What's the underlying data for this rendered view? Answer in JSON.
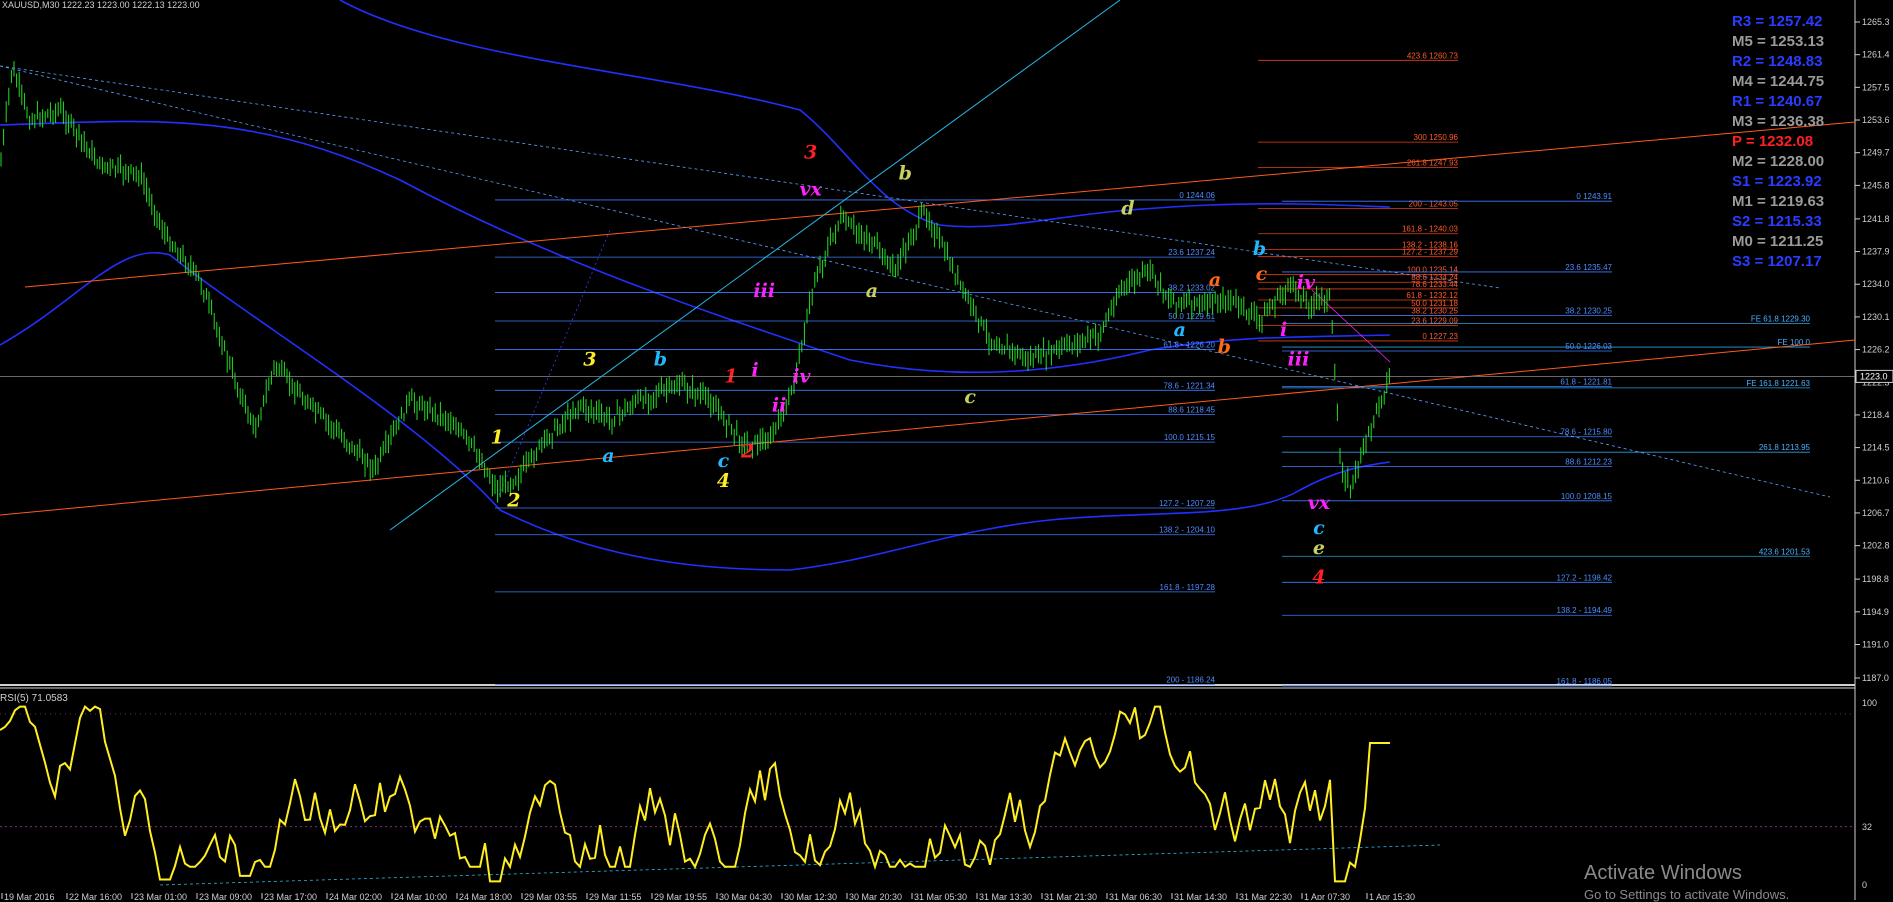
{
  "window_title": "XAUUSD,M30  1222.23 1223.00 1222.13 1223.00",
  "rsi_title": "RSI(5) 71.0583",
  "price_axis_labels": [
    "1265.3",
    "1261.4",
    "1257.5",
    "1253.6",
    "1249.7",
    "1245.8",
    "1241.8",
    "1237.9",
    "1234.0",
    "1230.1",
    "1226.2",
    "1222.3",
    "1218.4",
    "1214.5",
    "1210.6",
    "1206.7",
    "1202.8",
    "1198.8",
    "1194.9",
    "1191.0",
    "1187.0"
  ],
  "current_price": "1223.0",
  "rsi_axis_labels": [
    "100",
    "32",
    "0"
  ],
  "time_axis_labels": [
    "19 Mar 2016",
    "22 Mar 16:00",
    "23 Mar 01:00",
    "23 Mar 09:00",
    "23 Mar 17:00",
    "24 Mar 02:00",
    "24 Mar 10:00",
    "24 Mar 18:00",
    "29 Mar 03:55",
    "29 Mar 11:55",
    "29 Mar 19:55",
    "30 Mar 04:30",
    "30 Mar 12:30",
    "30 Mar 20:30",
    "31 Mar 05:30",
    "31 Mar 13:30",
    "31 Mar 21:30",
    "31 Mar 06:30",
    "31 Mar 14:30",
    "31 Mar 22:30",
    "1 Apr 07:30",
    "1 Apr 15:30"
  ],
  "pivots": [
    {
      "label": "R3 = 1257.42",
      "color": "#2a3cff"
    },
    {
      "label": "M5 = 1253.13",
      "color": "#9a9a9a"
    },
    {
      "label": "R2 = 1248.83",
      "color": "#2a3cff"
    },
    {
      "label": "M4 = 1244.75",
      "color": "#9a9a9a"
    },
    {
      "label": "R1 = 1240.67",
      "color": "#2a3cff"
    },
    {
      "label": "M3 = 1236.38",
      "color": "#9a9a9a"
    },
    {
      "label": "P   = 1232.08",
      "color": "#ff2020"
    },
    {
      "label": "M2 = 1228.00",
      "color": "#9a9a9a"
    },
    {
      "label": "S1 = 1223.92",
      "color": "#2a3cff"
    },
    {
      "label": "M1 = 1219.63",
      "color": "#9a9a9a"
    },
    {
      "label": "S2 = 1215.33",
      "color": "#2a3cff"
    },
    {
      "label": "M0 = 1211.25",
      "color": "#9a9a9a"
    },
    {
      "label": "S3 = 1207.17",
      "color": "#2a3cff"
    }
  ],
  "fib_left": [
    {
      "text": "0 1244.06",
      "price": 1244.06
    },
    {
      "text": "23.6 1237.24",
      "price": 1237.24
    },
    {
      "text": "38.2 1233.02",
      "price": 1233.02
    },
    {
      "text": "50.0 1229.61",
      "price": 1229.61
    },
    {
      "text": "61.8 - 1226.20",
      "price": 1226.2
    },
    {
      "text": "78.6 - 1221.34",
      "price": 1221.34
    },
    {
      "text": "88.6 1218.45",
      "price": 1218.45
    },
    {
      "text": "100.0 1215.15",
      "price": 1215.15
    },
    {
      "text": "127.2 - 1207.29",
      "price": 1207.29
    },
    {
      "text": "138.2 - 1204.10",
      "price": 1204.1
    },
    {
      "text": "161.8 - 1197.28",
      "price": 1197.28
    },
    {
      "text": "200 - 1186.24",
      "price": 1186.24
    }
  ],
  "fib_red": [
    {
      "text": "423.6 1260.73",
      "price": 1260.73
    },
    {
      "text": "300 1250.96",
      "price": 1250.96
    },
    {
      "text": "261.8 1247.93",
      "price": 1247.93
    },
    {
      "text": "200 - 1243.05",
      "price": 1243.05
    },
    {
      "text": "161.8 - 1240.03",
      "price": 1240.03
    },
    {
      "text": "138.2 - 1238.16",
      "price": 1238.16
    },
    {
      "text": "127.2 - 1237.29",
      "price": 1237.29
    },
    {
      "text": "100.0 1235.14",
      "price": 1235.14
    },
    {
      "text": "88.6 1234.24",
      "price": 1234.24
    },
    {
      "text": "78.6 1233.44",
      "price": 1233.44
    },
    {
      "text": "61.8 - 1232.12",
      "price": 1232.12
    },
    {
      "text": "50.0 1231.18",
      "price": 1231.18
    },
    {
      "text": "38.2 1230.25",
      "price": 1230.25
    },
    {
      "text": "23.6 1229.09",
      "price": 1229.09
    },
    {
      "text": "0 1227.23",
      "price": 1227.23
    }
  ],
  "fib_right": [
    {
      "text": "0 1243.91",
      "price": 1243.91
    },
    {
      "text": "23.6 1235.47",
      "price": 1235.47
    },
    {
      "text": "38.2 1230.25",
      "price": 1230.25
    },
    {
      "text": "50.0 1226.03",
      "price": 1226.03
    },
    {
      "text": "61.8 - 1221.81",
      "price": 1221.81
    },
    {
      "text": "78.6 - 1215.80",
      "price": 1215.8
    },
    {
      "text": "88.6 1212.23",
      "price": 1212.23
    },
    {
      "text": "100.0 1208.15",
      "price": 1208.15
    },
    {
      "text": "127.2 - 1198.42",
      "price": 1198.42
    },
    {
      "text": "138.2 - 1194.49",
      "price": 1194.49
    },
    {
      "text": "161.8 - 1186.05",
      "price": 1186.05
    }
  ],
  "fib_ext": [
    {
      "text": "FE 61.8 1229.30",
      "price": 1229.3
    },
    {
      "text": "FE 100.0",
      "price": 1226.5
    },
    {
      "text": "FE 161.8 1221.63",
      "price": 1221.63
    },
    {
      "text": "261.8 1213.95",
      "price": 1213.95
    },
    {
      "text": "423.6 1201.53",
      "price": 1201.53
    }
  ],
  "wave_labels": [
    {
      "text": "1",
      "color": "#ffee22",
      "price": 1215.0,
      "t": 0.268
    },
    {
      "text": "2",
      "color": "#ffee22",
      "price": 1207.5,
      "t": 0.277
    },
    {
      "text": "3",
      "color": "#ffee22",
      "price": 1224.3,
      "t": 0.318
    },
    {
      "text": "4",
      "color": "#ffee22",
      "price": 1209.8,
      "t": 0.39
    },
    {
      "text": "a",
      "color": "#22b8ff",
      "price": 1212.8,
      "t": 0.328
    },
    {
      "text": "b",
      "color": "#22b8ff",
      "price": 1224.3,
      "t": 0.356
    },
    {
      "text": "c",
      "color": "#22b8ff",
      "price": 1212.2,
      "t": 0.39
    },
    {
      "text": "1",
      "color": "#ff2020",
      "price": 1222.3,
      "t": 0.394
    },
    {
      "text": "2",
      "color": "#ff2020",
      "price": 1213.3,
      "t": 0.403
    },
    {
      "text": "3",
      "color": "#ff2020",
      "price": 1249.0,
      "t": 0.437
    },
    {
      "text": "4",
      "color": "#ff2020",
      "price": 1198.3,
      "t": 0.711
    },
    {
      "text": "i",
      "color": "#ff22ff",
      "price": 1223.0,
      "t": 0.407
    },
    {
      "text": "ii",
      "color": "#ff22ff",
      "price": 1218.8,
      "t": 0.42
    },
    {
      "text": "iii",
      "color": "#ff22ff",
      "price": 1232.5,
      "t": 0.412
    },
    {
      "text": "iv",
      "color": "#ff22ff",
      "price": 1222.3,
      "t": 0.432
    },
    {
      "text": "vx",
      "color": "#ff22ff",
      "price": 1244.6,
      "t": 0.437
    },
    {
      "text": "b",
      "color": "#c8d060",
      "price": 1246.5,
      "t": 0.488
    },
    {
      "text": "a",
      "color": "#c8d060",
      "price": 1232.5,
      "t": 0.47
    },
    {
      "text": "c",
      "color": "#c8d060",
      "price": 1219.8,
      "t": 0.523
    },
    {
      "text": "d",
      "color": "#c8d060",
      "price": 1242.3,
      "t": 0.608
    },
    {
      "text": "a",
      "color": "#22b8ff",
      "price": 1227.8,
      "t": 0.636
    },
    {
      "text": "b",
      "color": "#22b8ff",
      "price": 1237.5,
      "t": 0.679
    },
    {
      "text": "c",
      "color": "#22b8ff",
      "price": 1204.2,
      "t": 0.711
    },
    {
      "text": "a",
      "color": "#ff6a1a",
      "price": 1233.8,
      "t": 0.655
    },
    {
      "text": "b",
      "color": "#ff6a1a",
      "price": 1225.8,
      "t": 0.66
    },
    {
      "text": "c",
      "color": "#ff6a1a",
      "price": 1234.5,
      "t": 0.68
    },
    {
      "text": "i",
      "color": "#ff22ff",
      "price": 1227.8,
      "t": 0.692
    },
    {
      "text": "iii",
      "color": "#ff22ff",
      "price": 1224.3,
      "t": 0.7
    },
    {
      "text": "iv",
      "color": "#ff22ff",
      "price": 1233.5,
      "t": 0.704
    },
    {
      "text": "vx",
      "color": "#ff22ff",
      "price": 1207.2,
      "t": 0.711
    },
    {
      "text": "e",
      "color": "#c8d060",
      "price": 1201.8,
      "t": 0.711
    }
  ],
  "watermark": {
    "line1": "Activate Windows",
    "line2": "Go to Settings to activate Windows."
  }
}
